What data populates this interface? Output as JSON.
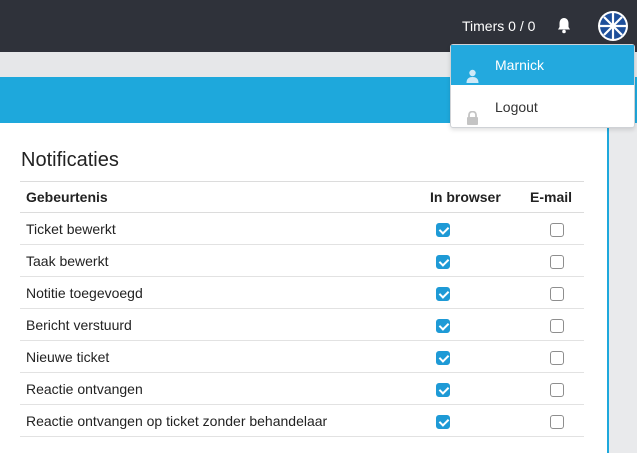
{
  "topbar": {
    "timers_label": "Timers 0 / 0",
    "bell_icon": "bell-icon",
    "avatar_icon": "avatar-icon"
  },
  "user_menu": {
    "items": [
      {
        "label": "Marnick",
        "icon": "user-icon",
        "active": true
      },
      {
        "label": "Logout",
        "icon": "lock-icon",
        "active": false
      }
    ]
  },
  "notifications": {
    "title": "Notificaties",
    "columns": [
      "Gebeurtenis",
      "In browser",
      "E-mail"
    ],
    "rows": [
      {
        "event": "Ticket bewerkt",
        "browser": true,
        "email": false
      },
      {
        "event": "Taak bewerkt",
        "browser": true,
        "email": false
      },
      {
        "event": "Notitie toegevoegd",
        "browser": true,
        "email": false
      },
      {
        "event": "Bericht verstuurd",
        "browser": true,
        "email": false
      },
      {
        "event": "Nieuwe ticket",
        "browser": true,
        "email": false
      },
      {
        "event": "Reactie ontvangen",
        "browser": true,
        "email": false
      },
      {
        "event": "Reactie ontvangen op ticket zonder behandelaar",
        "browser": true,
        "email": false
      }
    ]
  },
  "colors": {
    "topbar_bg": "#2f323a",
    "accent": "#1ea8dc",
    "checkbox_checked": "#1e9ad6"
  }
}
